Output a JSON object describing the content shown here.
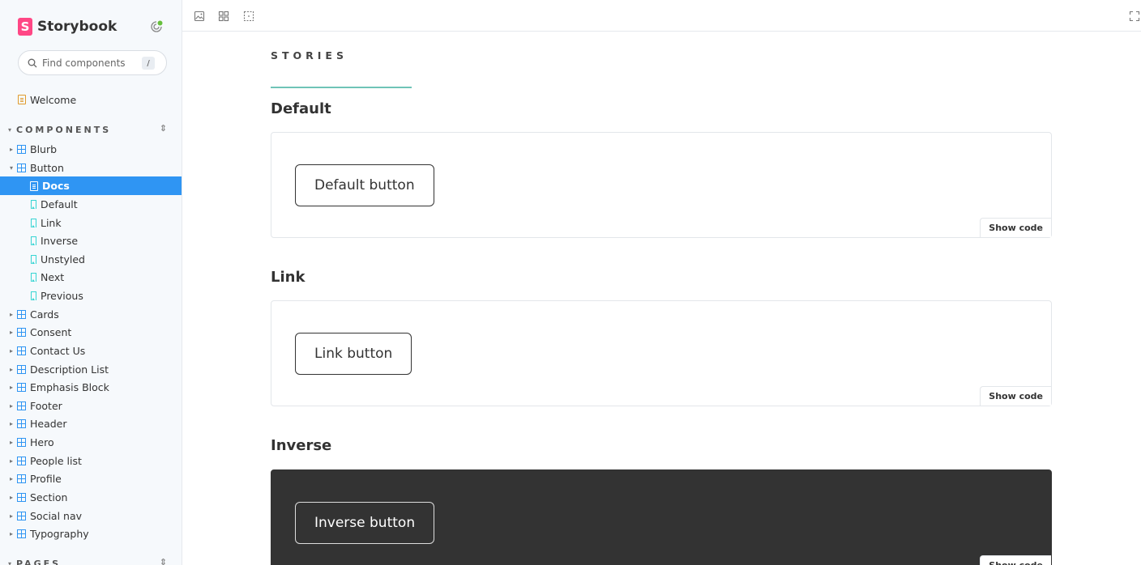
{
  "brand": {
    "name": "Storybook",
    "logo_letter": "S"
  },
  "search": {
    "placeholder": "Find components",
    "shortcut": "/"
  },
  "sidebar": {
    "welcome": "Welcome",
    "section_title": "COMPONENTS",
    "button": {
      "label": "Button",
      "children": [
        "Docs",
        "Default",
        "Link",
        "Inverse",
        "Unstyled",
        "Next",
        "Previous"
      ]
    },
    "components": [
      "Blurb",
      "Cards",
      "Consent",
      "Contact Us",
      "Description List",
      "Emphasis Block",
      "Footer",
      "Header",
      "Hero",
      "People list",
      "Profile",
      "Section",
      "Social nav",
      "Typography"
    ],
    "pages_section_partial": "PAGES"
  },
  "toolbar": {
    "icons": [
      "image-icon",
      "grid-icon",
      "outline-icon",
      "fullscreen-icon"
    ]
  },
  "docs": {
    "stories_label": "STORIES",
    "stories": [
      {
        "title": "Default",
        "button_label": "Default button",
        "show_code": "Show code",
        "theme": "light"
      },
      {
        "title": "Link",
        "button_label": "Link button",
        "show_code": "Show code",
        "theme": "light"
      },
      {
        "title": "Inverse",
        "button_label": "Inverse button",
        "show_code": "Show code",
        "theme": "dark"
      }
    ]
  },
  "colors": {
    "accent": "#2f95f3",
    "brand": "#ff4785",
    "stories_rule": "#6fc4b7",
    "inverse_bg": "#333333"
  }
}
